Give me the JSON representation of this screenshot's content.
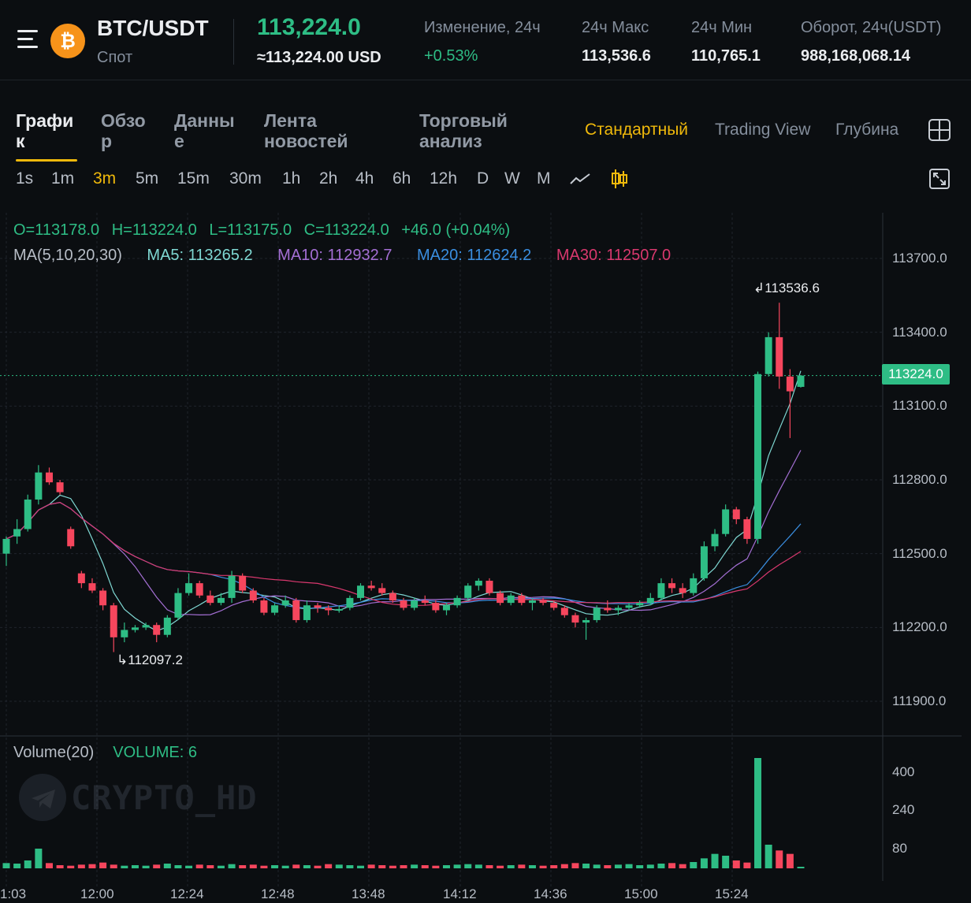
{
  "header": {
    "pair": "BTC/USDT",
    "market_type": "Спот",
    "coin_icon": "bitcoin-icon",
    "last_price": "113,224.0",
    "usd_price": "≈113,224.00 USD",
    "stats": [
      {
        "label": "Изменение, 24ч",
        "value": "+0.53%"
      },
      {
        "label": "24ч Макс",
        "value": "113,536.6"
      },
      {
        "label": "24ч Мин",
        "value": "110,765.1"
      },
      {
        "label": "Оборот, 24ч(USDT)",
        "value": "988,168,068.14"
      }
    ]
  },
  "tabs": [
    {
      "line1": "Графи",
      "line2": "к"
    },
    {
      "line1": "Обзо",
      "line2": "р"
    },
    {
      "line1": "Данны",
      "line2": "е"
    },
    {
      "line1": "Лента",
      "line2": "новостей"
    },
    {
      "line1": "Торговый",
      "line2": "анализ"
    }
  ],
  "view_options": [
    "Стандартный",
    "Trading View",
    "Глубина"
  ],
  "intervals": [
    "1s",
    "1m",
    "3m",
    "5m",
    "15m",
    "30m",
    "1h",
    "2h",
    "4h",
    "6h",
    "12h",
    "D",
    "W",
    "M"
  ],
  "active_interval": "3m",
  "ohlc": {
    "o": "O=113178.0",
    "h": "H=113224.0",
    "l": "L=113175.0",
    "c": "C=113224.0",
    "chg": "+46.0 (+0.04%)"
  },
  "ma": {
    "label": "MA(5,10,20,30)",
    "ma5": "MA5: 113265.2",
    "ma10": "MA10: 112932.7",
    "ma20": "MA20: 112624.2",
    "ma30": "MA30: 112507.0"
  },
  "volume": {
    "label": "Volume(20)",
    "value": "VOLUME: 6"
  },
  "watermark": "CRYPTO_HD",
  "colors": {
    "up": "#2ebd85",
    "down": "#f6465d",
    "accent": "#f0b90b",
    "ma5": "#7fd8d3",
    "ma10": "#a46fd4",
    "ma20": "#3a8ee0",
    "ma30": "#d9386e"
  },
  "chart_data": {
    "type": "candlestick",
    "x_ticks": [
      "1:03",
      "12:00",
      "12:24",
      "12:48",
      "13:48",
      "14:12",
      "14:36",
      "15:00",
      "15:24"
    ],
    "y_ticks": [
      "113700.0",
      "113400.0",
      "113100.0",
      "112800.0",
      "112500.0",
      "112200.0",
      "111900.0"
    ],
    "ylim": [
      111800,
      113800
    ],
    "current_price": "113224.0",
    "high_marker": "113536.6",
    "low_marker": "112097.2",
    "volume_ticks": [
      "400",
      "240",
      "80"
    ],
    "volume_ylim": [
      0,
      450
    ],
    "candles": [
      [
        112500,
        112570,
        112450,
        112560
      ],
      [
        112570,
        112640,
        112540,
        112600
      ],
      [
        112600,
        112740,
        112590,
        112720
      ],
      [
        112720,
        112860,
        112700,
        112830
      ],
      [
        112830,
        112850,
        112780,
        112790
      ],
      [
        112790,
        112800,
        112740,
        112750
      ],
      [
        112600,
        112610,
        112520,
        112530
      ],
      [
        112420,
        112430,
        112360,
        112380
      ],
      [
        112380,
        112400,
        112340,
        112350
      ],
      [
        112350,
        112360,
        112270,
        112290
      ],
      [
        112290,
        112300,
        112100,
        112160
      ],
      [
        112160,
        112220,
        112140,
        112190
      ],
      [
        112190,
        112210,
        112180,
        112200
      ],
      [
        112200,
        112220,
        112190,
        112210
      ],
      [
        112210,
        112220,
        112140,
        112170
      ],
      [
        112170,
        112250,
        112160,
        112240
      ],
      [
        112240,
        112360,
        112230,
        112340
      ],
      [
        112340,
        112420,
        112330,
        112380
      ],
      [
        112380,
        112390,
        112320,
        112330
      ],
      [
        112330,
        112350,
        112290,
        112300
      ],
      [
        112300,
        112340,
        112290,
        112320
      ],
      [
        112320,
        112430,
        112300,
        112410
      ],
      [
        112410,
        112420,
        112340,
        112350
      ],
      [
        112350,
        112360,
        112300,
        112310
      ],
      [
        112310,
        112320,
        112250,
        112260
      ],
      [
        112260,
        112300,
        112250,
        112290
      ],
      [
        112290,
        112330,
        112280,
        112310
      ],
      [
        112310,
        112320,
        112220,
        112230
      ],
      [
        112230,
        112310,
        112220,
        112290
      ],
      [
        112290,
        112300,
        112260,
        112280
      ],
      [
        112280,
        112290,
        112250,
        112270
      ],
      [
        112270,
        112290,
        112260,
        112275
      ],
      [
        112280,
        112330,
        112270,
        112320
      ],
      [
        112320,
        112380,
        112310,
        112370
      ],
      [
        112370,
        112390,
        112350,
        112360
      ],
      [
        112360,
        112380,
        112330,
        112340
      ],
      [
        112340,
        112350,
        112300,
        112310
      ],
      [
        112310,
        112320,
        112270,
        112280
      ],
      [
        112280,
        112320,
        112270,
        112310
      ],
      [
        112310,
        112330,
        112290,
        112300
      ],
      [
        112300,
        112310,
        112260,
        112270
      ],
      [
        112270,
        112300,
        112250,
        112290
      ],
      [
        112290,
        112330,
        112280,
        112320
      ],
      [
        112320,
        112380,
        112310,
        112370
      ],
      [
        112370,
        112400,
        112350,
        112390
      ],
      [
        112390,
        112400,
        112330,
        112340
      ],
      [
        112340,
        112350,
        112290,
        112300
      ],
      [
        112300,
        112340,
        112290,
        112330
      ],
      [
        112330,
        112340,
        112290,
        112300
      ],
      [
        112300,
        112320,
        112270,
        112310
      ],
      [
        112310,
        112320,
        112290,
        112300
      ],
      [
        112300,
        112310,
        112270,
        112280
      ],
      [
        112280,
        112290,
        112240,
        112250
      ],
      [
        112250,
        112260,
        112200,
        112220
      ],
      [
        112220,
        112240,
        112150,
        112230
      ],
      [
        112230,
        112290,
        112220,
        112280
      ],
      [
        112280,
        112310,
        112260,
        112270
      ],
      [
        112270,
        112290,
        112250,
        112280
      ],
      [
        112280,
        112300,
        112270,
        112290
      ],
      [
        112290,
        112310,
        112280,
        112300
      ],
      [
        112300,
        112340,
        112290,
        112320
      ],
      [
        112320,
        112400,
        112310,
        112380
      ],
      [
        112380,
        112400,
        112340,
        112360
      ],
      [
        112360,
        112380,
        112320,
        112340
      ],
      [
        112340,
        112420,
        112330,
        112400
      ],
      [
        112400,
        112550,
        112390,
        112530
      ],
      [
        112530,
        112600,
        112510,
        112580
      ],
      [
        112580,
        112700,
        112570,
        112680
      ],
      [
        112680,
        112690,
        112620,
        112640
      ],
      [
        112640,
        112650,
        112540,
        112560
      ],
      [
        112560,
        113240,
        112540,
        113230
      ],
      [
        113230,
        113400,
        113220,
        113380
      ],
      [
        113380,
        113520,
        113170,
        113220
      ],
      [
        113220,
        113250,
        112970,
        113160
      ],
      [
        113178,
        113224,
        113175,
        113224
      ]
    ],
    "volumes": [
      20,
      18,
      30,
      75,
      20,
      12,
      10,
      14,
      16,
      22,
      14,
      10,
      12,
      10,
      14,
      18,
      12,
      10,
      14,
      12,
      10,
      16,
      12,
      14,
      10,
      12,
      10,
      14,
      12,
      10,
      16,
      14,
      12,
      10,
      14,
      12,
      10,
      12,
      14,
      12,
      10,
      12,
      14,
      16,
      14,
      12,
      10,
      12,
      14,
      12,
      10,
      12,
      16,
      20,
      18,
      14,
      12,
      14,
      16,
      12,
      14,
      18,
      20,
      16,
      24,
      38,
      55,
      48,
      30,
      22,
      420,
      90,
      68,
      55,
      6
    ]
  }
}
